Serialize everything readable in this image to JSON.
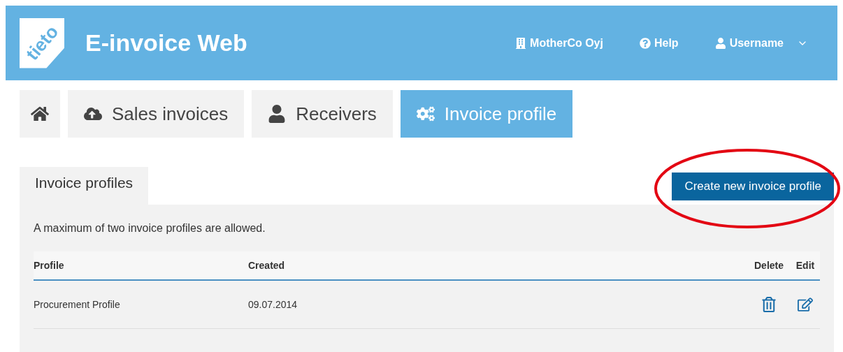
{
  "header": {
    "logo": "tieto",
    "title": "E-invoice Web",
    "company": "MotherCo Oyj",
    "help": "Help",
    "user": "Username"
  },
  "nav": [
    {
      "kind": "home",
      "selected": false
    },
    {
      "kind": "upload",
      "label": "Sales invoices",
      "selected": false
    },
    {
      "kind": "user",
      "label": "Receivers",
      "selected": false
    },
    {
      "kind": "gears",
      "label": "Invoice profile",
      "selected": true
    }
  ],
  "panel": {
    "tab": "Invoice profiles",
    "create_button": "Create new invoice profile",
    "highlighted": true,
    "note": "A maximum of two invoice profiles are allowed.",
    "table": {
      "columns": [
        "Profile",
        "Created",
        "Delete",
        "Edit"
      ],
      "rows": [
        {
          "profile": "Procurement Profile",
          "created": "09.07.2014"
        }
      ]
    }
  }
}
